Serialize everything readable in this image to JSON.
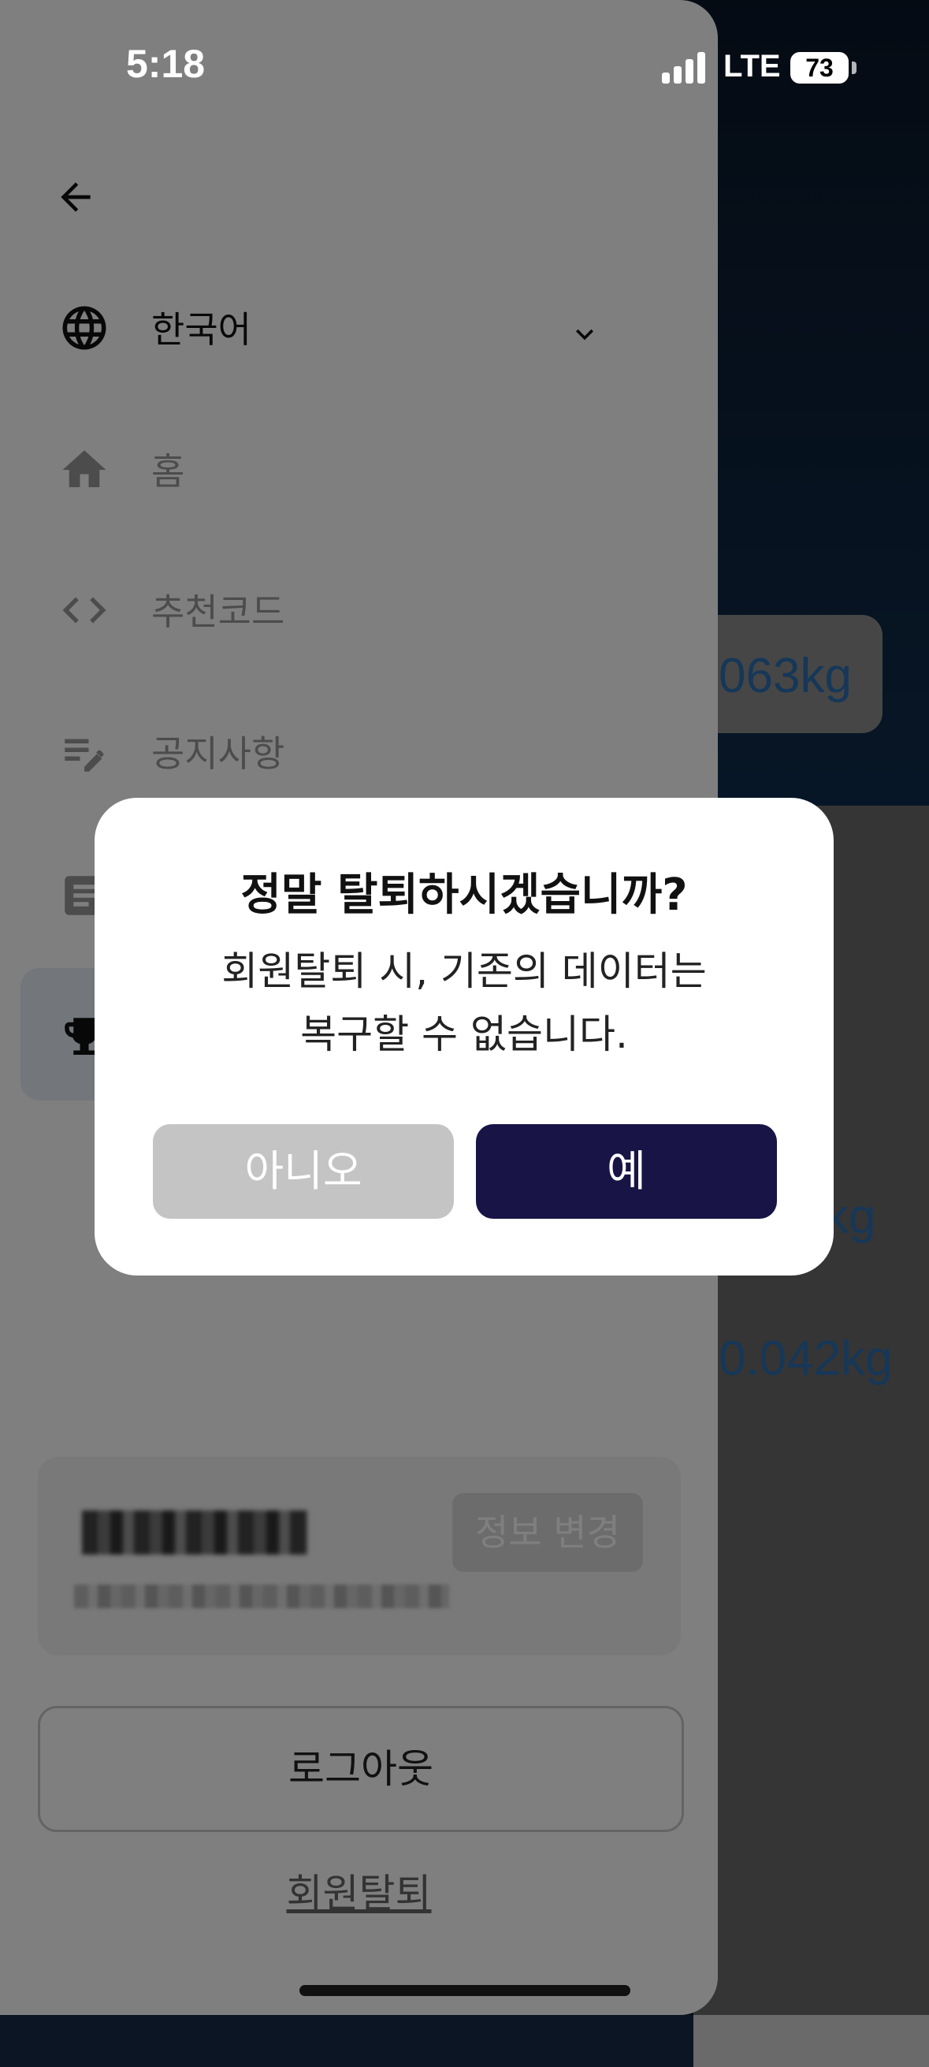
{
  "status_bar": {
    "time": "5:18",
    "network": "LTE",
    "battery": "73"
  },
  "background": {
    "values": [
      "063kg",
      "kg",
      "0.042kg"
    ]
  },
  "drawer": {
    "language": "한국어",
    "menu": [
      {
        "label": "홈",
        "icon": "home-icon"
      },
      {
        "label": "추천코드",
        "icon": "code-icon"
      },
      {
        "label": "공지사항",
        "icon": "notes-edit-icon"
      },
      {
        "label": "",
        "icon": "article-icon"
      },
      {
        "label": "",
        "icon": "trophy-icon"
      }
    ],
    "edit_info": "정보 변경",
    "logout": "로그아웃",
    "withdraw": "회원탈퇴"
  },
  "dialog": {
    "title": "정말 탈퇴하시겠습니까?",
    "message_line1": "회원탈퇴 시, 기존의 데이터는",
    "message_line2": "복구할 수 없습니다.",
    "no_label": "아니오",
    "yes_label": "예"
  },
  "colors": {
    "confirm": "#181446",
    "cancel": "#c4c4c4",
    "link_value": "#2d6fb0"
  }
}
